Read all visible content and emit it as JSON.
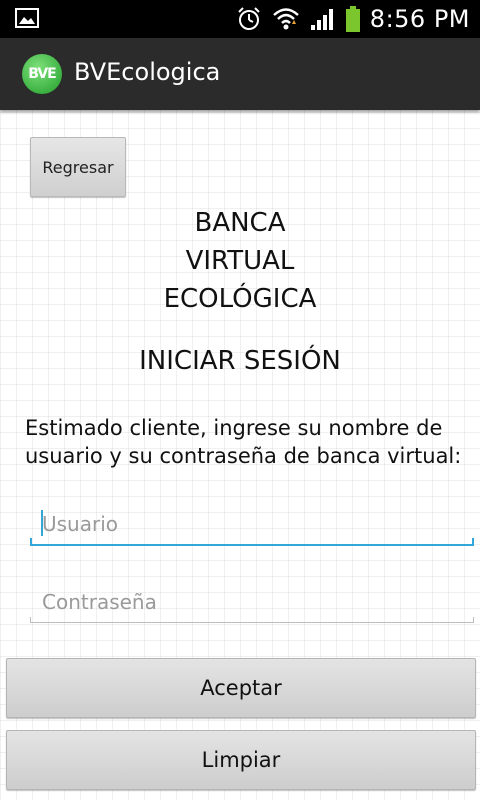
{
  "status_bar": {
    "time": "8:56 PM",
    "left_icon": "image-notification-icon",
    "right_icons": [
      "alarm-icon",
      "wifi-icon",
      "signal-icon",
      "battery-icon"
    ]
  },
  "action_bar": {
    "logo_text": "BVE",
    "title": "BVEcologica"
  },
  "main": {
    "back_button": "Regresar",
    "bank_title_lines": [
      "BANCA",
      "VIRTUAL",
      "ECOLÓGICA"
    ],
    "login_title": "INICIAR SESIÓN",
    "instructions": "Estimado cliente, ingrese su nombre de usuario y su contraseña de banca virtual:",
    "username": {
      "value": "",
      "placeholder": "Usuario"
    },
    "password": {
      "value": "",
      "placeholder": "Contraseña"
    },
    "accept_button": "Aceptar",
    "clear_button": "Limpiar"
  },
  "colors": {
    "accent": "#33a7d8",
    "action_bar": "#2b2b2b",
    "battery": "#7cc62d"
  }
}
